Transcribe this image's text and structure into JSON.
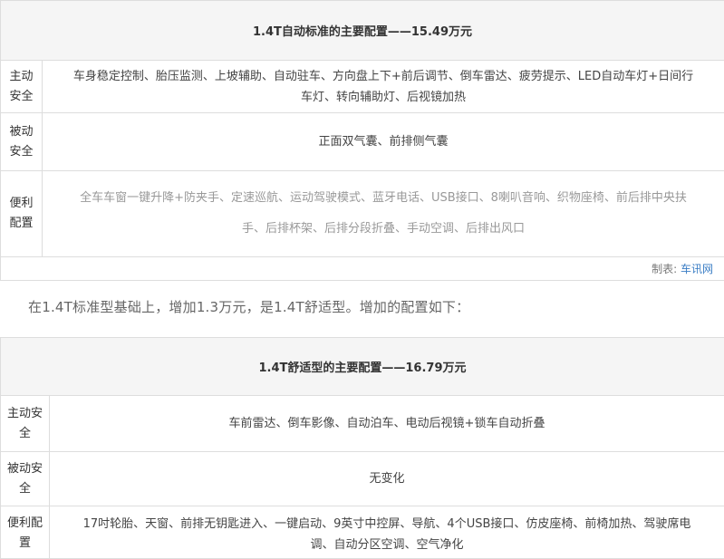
{
  "table1": {
    "title": "1.4T自动标准的主要配置——15.49万元",
    "rows": [
      {
        "label_line1": "主动",
        "label_line2": "安全",
        "content_line1": "车身稳定控制、胎压监测、上坡辅助、自动驻车、方向盘上下+前后调节、倒车雷达、疲劳提示、LED自动车灯+日间行",
        "content_line2": "车灯、转向辅助灯、后视镜加热"
      },
      {
        "label_line1": "被动",
        "label_line2": "安全",
        "content": "正面双气囊、前排侧气囊"
      },
      {
        "label_line1": "便利",
        "label_line2": "配置",
        "content_line1": "全车车窗一键升降+防夹手、定速巡航、运动驾驶模式、蓝牙电话、USB接口、8喇叭音响、织物座椅、前后排中央扶",
        "content_line2": "手、后排杯架、后排分段折叠、手动空调、后排出风口"
      }
    ],
    "source_prefix": "制表: ",
    "source_name": "车讯网"
  },
  "intro_text": "在1.4T标准型基础上，增加1.3万元，是1.4T舒适型。增加的配置如下：",
  "table2": {
    "title": "1.4T舒适型的主要配置——16.79万元",
    "rows": [
      {
        "label_line1": "主动安",
        "label_line2": "全",
        "content": "车前雷达、倒车影像、自动泊车、电动后视镜+锁车自动折叠"
      },
      {
        "label_line1": "被动安",
        "label_line2": "全",
        "content": "无变化"
      },
      {
        "label_line1": "便利配",
        "label_line2": "置",
        "content_line1": "17吋轮胎、天窗、前排无钥匙进入、一键启动、9英寸中控屏、导航、4个USB接口、仿皮座椅、前椅加热、驾驶席电",
        "content_line2": "调、自动分区空调、空气净化"
      }
    ]
  }
}
